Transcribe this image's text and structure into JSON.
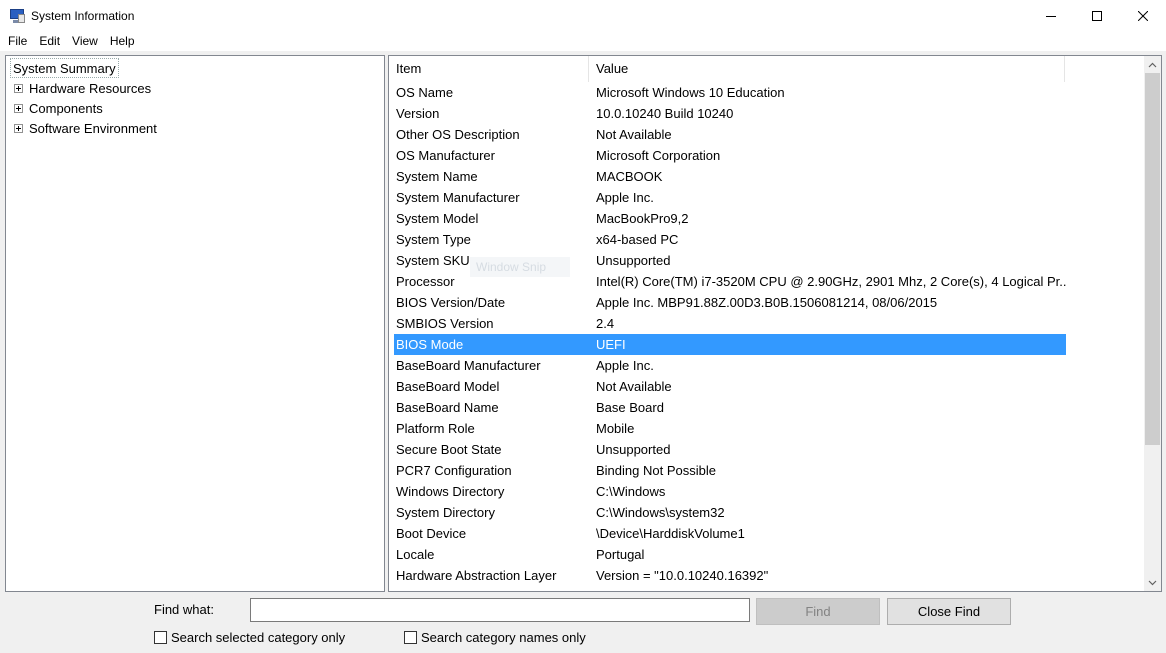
{
  "window": {
    "title": "System Information"
  },
  "menu": [
    "File",
    "Edit",
    "View",
    "Help"
  ],
  "tree": {
    "root": "System Summary",
    "children": [
      "Hardware Resources",
      "Components",
      "Software Environment"
    ]
  },
  "table": {
    "columns": [
      "Item",
      "Value"
    ],
    "rows": [
      {
        "item": "OS Name",
        "value": "Microsoft Windows 10 Education"
      },
      {
        "item": "Version",
        "value": "10.0.10240 Build 10240"
      },
      {
        "item": "Other OS Description",
        "value": "Not Available"
      },
      {
        "item": "OS Manufacturer",
        "value": "Microsoft Corporation"
      },
      {
        "item": "System Name",
        "value": "MACBOOK"
      },
      {
        "item": "System Manufacturer",
        "value": "Apple Inc."
      },
      {
        "item": "System Model",
        "value": "MacBookPro9,2"
      },
      {
        "item": "System Type",
        "value": "x64-based PC"
      },
      {
        "item": "System SKU",
        "value": "Unsupported"
      },
      {
        "item": "Processor",
        "value": "Intel(R) Core(TM) i7-3520M CPU @ 2.90GHz, 2901 Mhz, 2 Core(s), 4 Logical Pr..."
      },
      {
        "item": "BIOS Version/Date",
        "value": "Apple Inc. MBP91.88Z.00D3.B0B.1506081214, 08/06/2015"
      },
      {
        "item": "SMBIOS Version",
        "value": "2.4"
      },
      {
        "item": "BIOS Mode",
        "value": "UEFI"
      },
      {
        "item": "BaseBoard Manufacturer",
        "value": "Apple Inc."
      },
      {
        "item": "BaseBoard Model",
        "value": "Not Available"
      },
      {
        "item": "BaseBoard Name",
        "value": "Base Board"
      },
      {
        "item": "Platform Role",
        "value": "Mobile"
      },
      {
        "item": "Secure Boot State",
        "value": "Unsupported"
      },
      {
        "item": "PCR7 Configuration",
        "value": "Binding Not Possible"
      },
      {
        "item": "Windows Directory",
        "value": "C:\\Windows"
      },
      {
        "item": "System Directory",
        "value": "C:\\Windows\\system32"
      },
      {
        "item": "Boot Device",
        "value": "\\Device\\HarddiskVolume1"
      },
      {
        "item": "Locale",
        "value": "Portugal"
      },
      {
        "item": "Hardware Abstraction Layer",
        "value": "Version = \"10.0.10240.16392\""
      }
    ],
    "selected_row": "BIOS Mode"
  },
  "overlay": {
    "ghost_text": "Window Snip"
  },
  "find": {
    "label": "Find what:",
    "value": "",
    "find_button": "Find",
    "close_button": "Close Find",
    "search_selected": "Search selected category only",
    "search_names": "Search category names only"
  },
  "colors": {
    "selection": "#3399ff",
    "border": "#828790"
  }
}
